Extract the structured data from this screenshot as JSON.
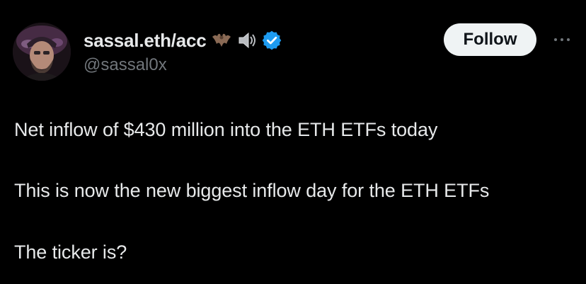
{
  "author": {
    "display_name": "sassal.eth/acc",
    "handle": "@sassal0x",
    "avatar_icon": "user-avatar-photo",
    "name_emojis": [
      "bat-icon",
      "speaker-icon"
    ],
    "verified_icon": "verified-badge-icon"
  },
  "actions": {
    "follow_label": "Follow",
    "more_icon": "more-dots-icon"
  },
  "tweet": {
    "lines": [
      "Net inflow of $430 million into the ETH ETFs today",
      "This is now the new biggest inflow day for the ETH ETFs",
      "The ticker is?"
    ]
  },
  "colors": {
    "background": "#000000",
    "primary_text": "#e7e9ea",
    "secondary_text": "#71767b",
    "follow_bg": "#eff3f4",
    "follow_text": "#0f1419",
    "verified_blue": "#1d9bf0"
  }
}
